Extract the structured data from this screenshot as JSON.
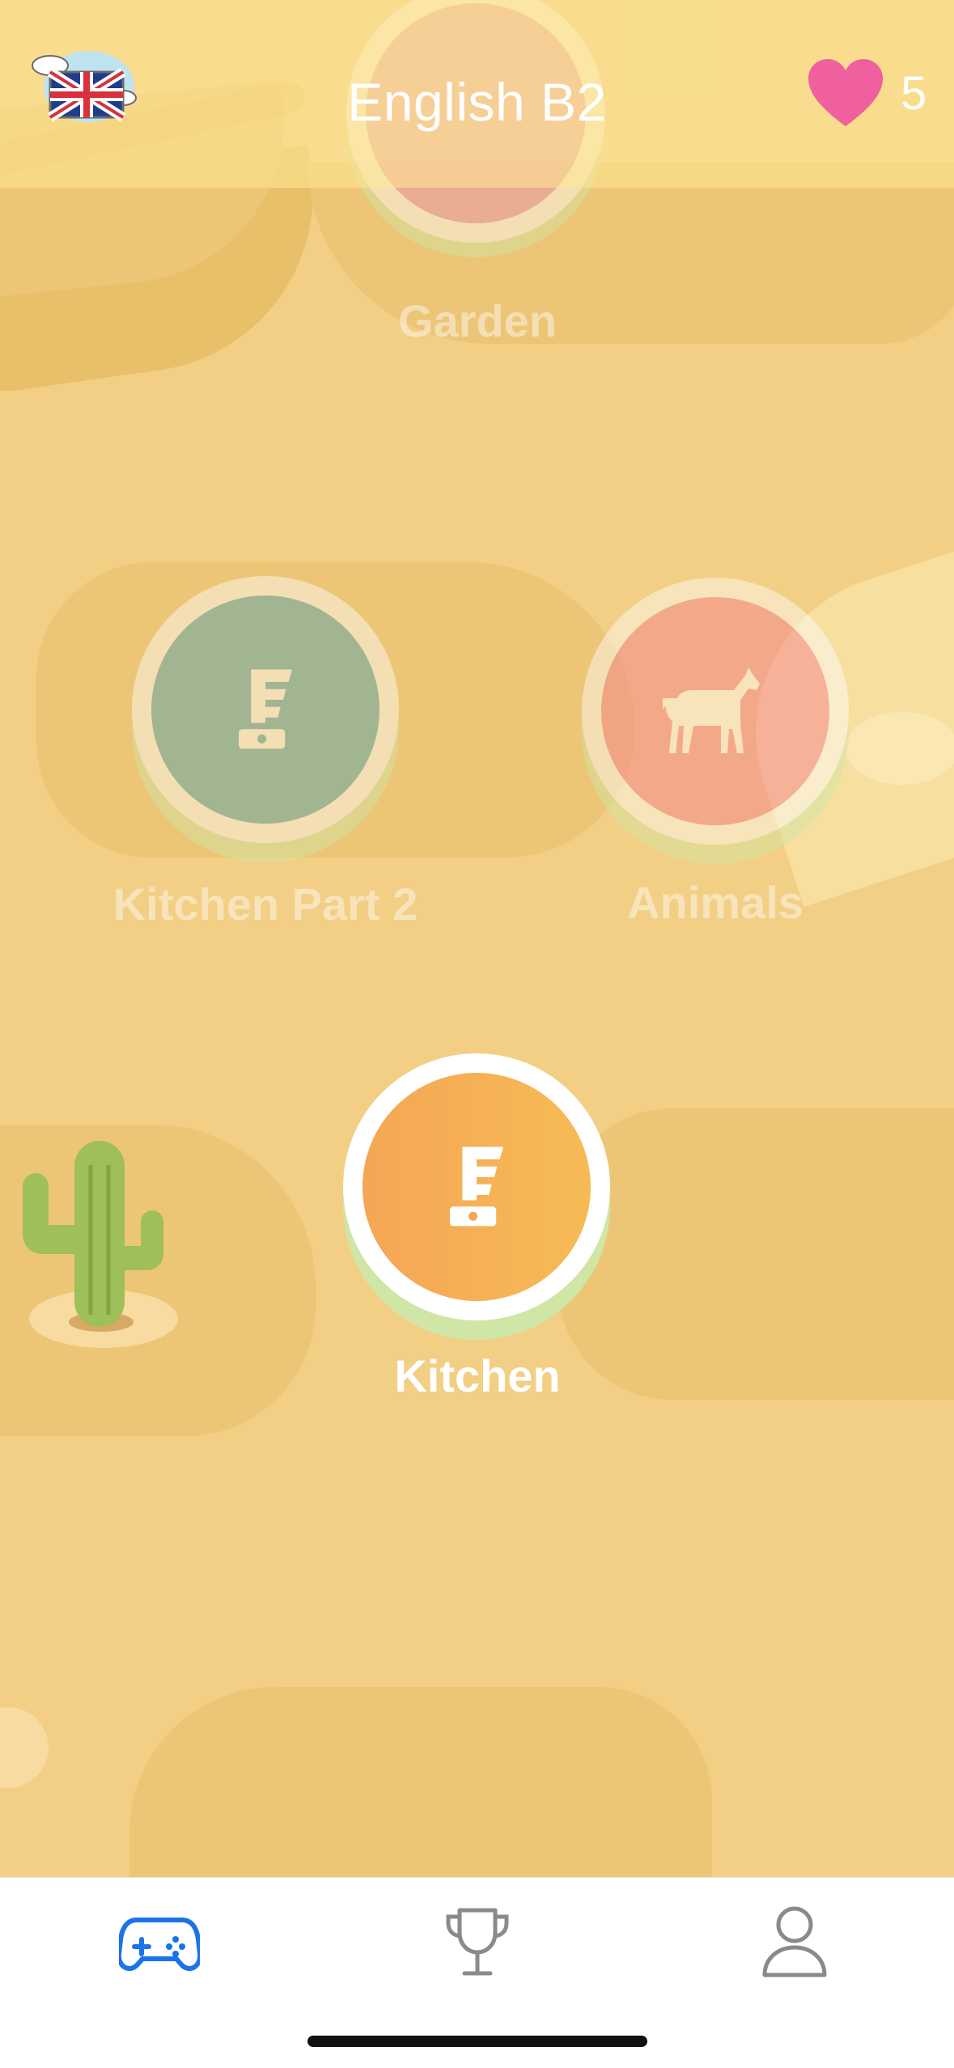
{
  "header": {
    "title": "English B2",
    "lives": "5",
    "flag_icon": "uk-flag-icon",
    "heart_icon": "heart-icon",
    "heart_color": "#f0609e"
  },
  "levels": [
    {
      "label": "Garden",
      "state": "locked",
      "color": "#ebb2c7"
    },
    {
      "label": "Kitchen Part 2",
      "state": "locked",
      "icon": "blender-icon",
      "color": "#9cc5c2"
    },
    {
      "label": "Animals",
      "state": "locked",
      "icon": "horse-icon",
      "color": "#f6a5ad"
    },
    {
      "label": "Kitchen",
      "state": "current",
      "icon": "blender-icon",
      "color": "#f6ad57"
    }
  ],
  "tabbar": {
    "tabs": [
      {
        "name": "games",
        "icon": "gamepad-icon",
        "active": true
      },
      {
        "name": "leaderboard",
        "icon": "trophy-icon",
        "active": false
      },
      {
        "name": "profile",
        "icon": "person-icon",
        "active": false
      }
    ],
    "active_color": "#1a73e8",
    "inactive_color": "#8a8a8a"
  }
}
